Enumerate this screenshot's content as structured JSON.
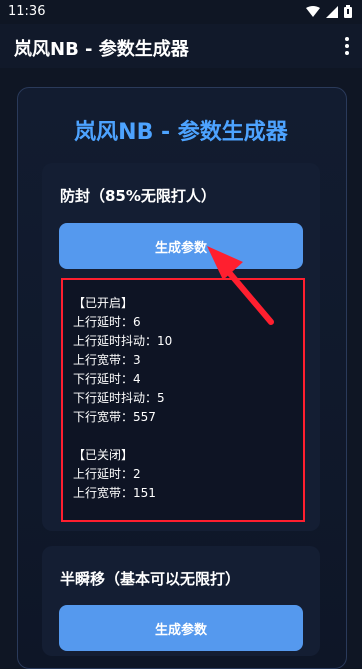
{
  "status": {
    "time": "11:36"
  },
  "app": {
    "title": "岚风NB - 参数生成器"
  },
  "main": {
    "title": "岚风NB - 参数生成器"
  },
  "sections": [
    {
      "title": "防封（85%无限打人）",
      "button_label": "生成参数",
      "output": {
        "enabled_header": "【已开启】",
        "enabled_lines": [
          "上行延时：6",
          "上行延时抖动：10",
          "上行宽带：3",
          "下行延时：4",
          "下行延时抖动：5",
          "下行宽带：557"
        ],
        "disabled_header": "【已关闭】",
        "disabled_lines": [
          "上行延时：2",
          "上行宽带：151"
        ]
      }
    },
    {
      "title": "半瞬移（基本可以无限打）",
      "button_label": "生成参数"
    }
  ],
  "colors": {
    "accent": "#4da3ff",
    "button": "#5599ee",
    "highlight": "#ff1f2f"
  },
  "icons": [
    "wifi-icon",
    "cellular-signal-icon",
    "battery-icon",
    "overflow-menu-icon",
    "red-arrow-annotation"
  ]
}
